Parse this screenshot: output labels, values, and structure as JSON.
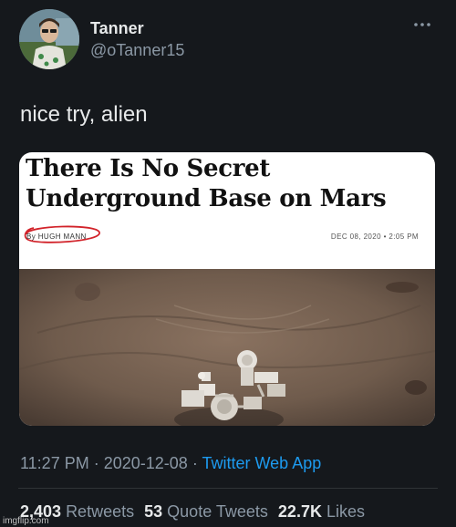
{
  "author": {
    "display_name": "Tanner",
    "handle": "@oTanner15"
  },
  "tweet": {
    "text": "nice try, alien",
    "time": "11:27 PM",
    "date": "2020-12-08",
    "source": "Twitter Web App"
  },
  "article": {
    "headline_line1": "There Is No Secret",
    "headline_line2": "Underground Base on Mars",
    "byline": "By HUGH MANN",
    "dateline": "DEC 08, 2020 • 2:05 PM"
  },
  "stats": {
    "retweets_count": "2,403",
    "retweets_label": "Retweets",
    "quotes_count": "53",
    "quotes_label": "Quote Tweets",
    "likes_count": "22.7K",
    "likes_label": "Likes"
  },
  "watermark": "imgflip.com",
  "icons": {
    "more": "more-horizontal-icon"
  },
  "colors": {
    "background": "#15181c",
    "link": "#1d9bf0",
    "secondary_text": "#8b98a5",
    "byline_circle": "#d2232a"
  }
}
